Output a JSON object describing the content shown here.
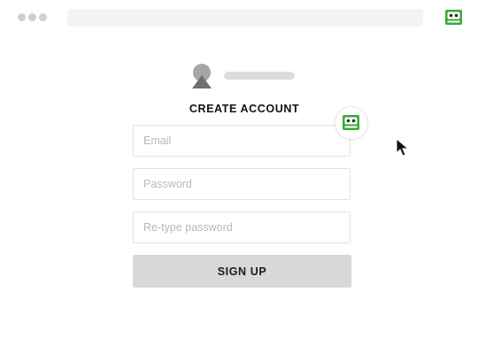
{
  "form": {
    "title": "CREATE ACCOUNT",
    "fields": [
      {
        "name": "email",
        "placeholder": "Email",
        "value": ""
      },
      {
        "name": "password",
        "placeholder": "Password",
        "value": ""
      },
      {
        "name": "retype_password",
        "placeholder": "Re-type password",
        "value": ""
      }
    ],
    "submit_label": "SIGN UP"
  },
  "icons": {
    "window_controls": "traffic-light-dots",
    "extension": "roboform-icon",
    "autofill_bubble": "roboform-icon",
    "avatar": "user-avatar-icon",
    "pointer": "mouse-cursor-icon"
  },
  "colors": {
    "brand_green": "#3aaa35",
    "button_bg": "#d8d8d8",
    "field_border": "#e2e2e2",
    "placeholder": "#b9b9b9",
    "text": "#111111"
  }
}
